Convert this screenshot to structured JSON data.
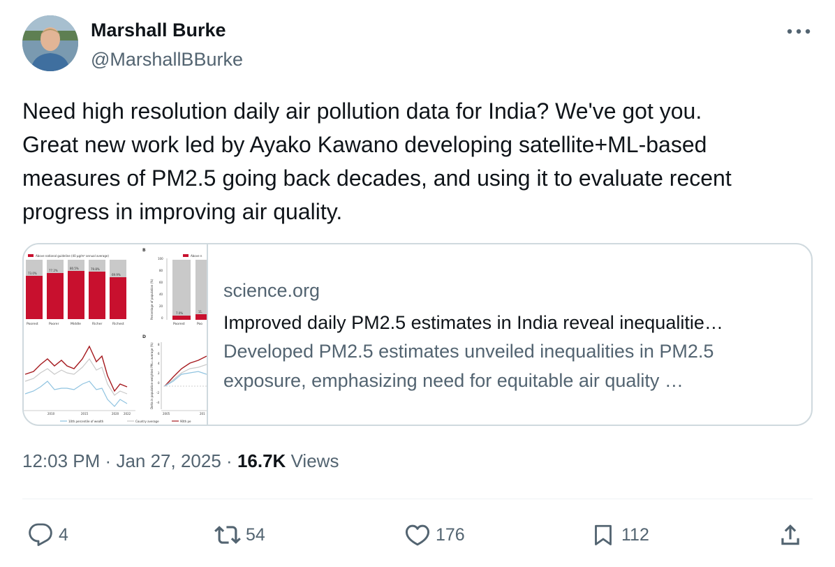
{
  "author": {
    "name": "Marshall Burke",
    "handle": "@MarshallBBurke"
  },
  "tweet": {
    "lines": [
      "Need high resolution daily air pollution data for India?  We've got you.",
      "Great new work led by Ayako Kawano developing satellite+ML-based",
      "measures of PM2.5 going back decades, and using it to evaluate recent",
      "progress in improving air quality."
    ]
  },
  "card": {
    "domain": "science.org",
    "title": "Improved daily PM2.5 estimates in India reveal inequalitie…",
    "description_lines": [
      "Developed PM2.5 estimates unveiled inequalities in PM2.5",
      "exposure, emphasizing need for equitable air quality …"
    ],
    "thumbnail": {
      "panel_b_label": "B",
      "panel_d_label": "D",
      "legend_a": "Above national guideline (40 μg/m³ annual average)",
      "legend_b": "Above n",
      "bar_values": [
        "73.0%",
        "77.2%",
        "80.5%",
        "79.8%",
        "69.9%"
      ],
      "bar_categories": [
        "Poorest",
        "Poorer",
        "Middle",
        "Richer",
        "Richest"
      ],
      "small_bar_values": [
        "7.0%",
        "11."
      ],
      "small_bar_categories": [
        "Poorest",
        "Poo"
      ],
      "y_axis_b_label": "Percentage of population (%)",
      "y_axis_b_ticks": [
        "100",
        "80",
        "60",
        "40",
        "20",
        "0"
      ],
      "y_axis_d_label": "Delta in population-weighted PM₂.₅ average (%)",
      "y_axis_d_ticks": [
        "8",
        "6",
        "4",
        "2",
        "0",
        "-2",
        "-4"
      ],
      "x_ticks_c": [
        "2010",
        "2015",
        "2020",
        "2022"
      ],
      "x_ticks_d": [
        "2005",
        "201"
      ],
      "line_legend": [
        "10th percentile of wealth",
        "Country average",
        "90th pe"
      ],
      "colors": {
        "red": "#c8102e",
        "gray": "#c9c9c9",
        "blue": "#8fc3e0"
      }
    }
  },
  "meta": {
    "time": "12:03 PM",
    "separator": "·",
    "date": "Jan 27, 2025",
    "views_count": "16.7K",
    "views_label": "Views"
  },
  "actions": {
    "replies": "4",
    "reposts": "54",
    "likes": "176",
    "bookmarks": "112"
  },
  "icons": [
    "more-icon",
    "reply-icon",
    "repost-icon",
    "like-icon",
    "bookmark-icon",
    "share-icon"
  ]
}
